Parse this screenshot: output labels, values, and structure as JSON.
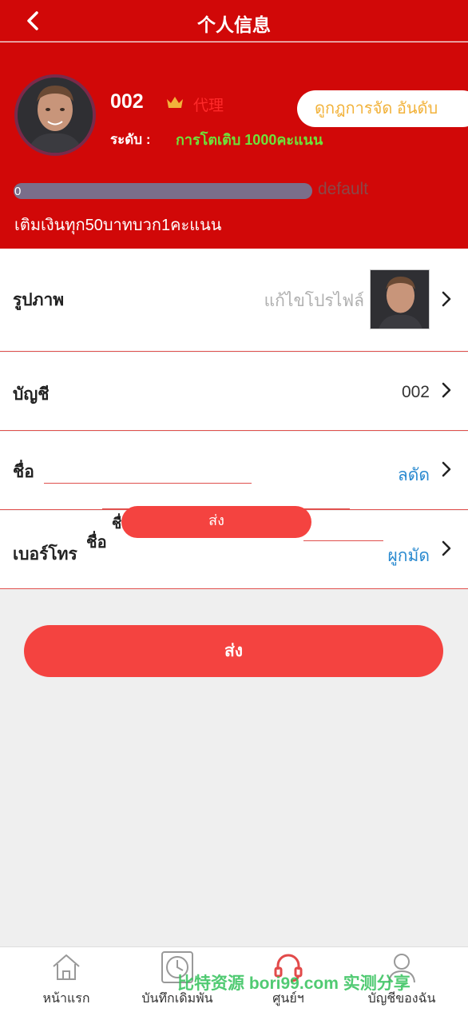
{
  "header": {
    "title": "个人信息"
  },
  "profile": {
    "user_id": "002",
    "agent_label": "代理",
    "rules_button": "ดูกฎการจัด อันดับ",
    "level_label": "ระดับ :",
    "level_value": "การโตเติบ 1000คะแนน",
    "progress": {
      "value": "0",
      "fraction": 0,
      "tag": "default"
    },
    "deposit_note": "เติมเงินทุก50บาทบวก1คะแนน"
  },
  "rows": {
    "photo": {
      "label": "รูปภาพ",
      "hint": "แก้ไขโปรไฟล์"
    },
    "account": {
      "label": "บัญชี",
      "value": "002"
    },
    "name": {
      "label": "ชื่อ",
      "value": "ลดัด"
    },
    "phone": {
      "label": "เบอร์โทร",
      "value": "ผูกมัด"
    }
  },
  "overlay": {
    "label1": "ชื่อ",
    "label2": "ชื่อ",
    "button": "ส่ง"
  },
  "submit_label": "ส่ง",
  "tabs": [
    {
      "label": "หน้าแรก",
      "icon": "home-icon"
    },
    {
      "label": "บันทึกเดิมพัน",
      "icon": "clock-icon"
    },
    {
      "label": "ศูนย์ฯ",
      "icon": "support-icon"
    },
    {
      "label": "บัญชีของฉัน",
      "icon": "user-icon"
    }
  ],
  "watermark": "比特资源 bori99.com 实测分享",
  "colors": {
    "primary": "#d10808",
    "button": "#f44340",
    "level_green": "#6ee23a",
    "rules_gold": "#f2b23a",
    "link_blue": "#2a8ad0"
  }
}
